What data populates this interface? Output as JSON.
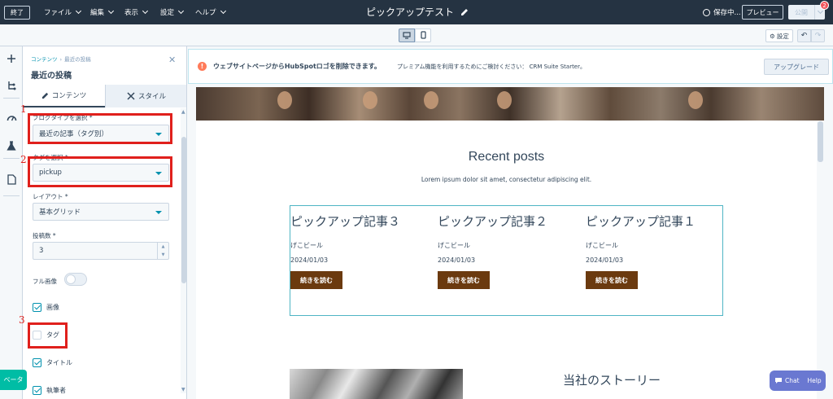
{
  "topbar": {
    "exit": "終了",
    "menus": [
      "ファイル",
      "編集",
      "表示",
      "設定",
      "ヘルプ"
    ],
    "title": "ピックアップテスト",
    "saving": "保存中...",
    "preview": "プレビュー",
    "publish": "公開",
    "notifications": "2"
  },
  "toolbar2": {
    "settings": "設定",
    "undo": "↶",
    "redo": "↷"
  },
  "panel": {
    "breadcrumb_root": "コンテンツ",
    "breadcrumb_sep": "›",
    "breadcrumb_current": "最近の投稿",
    "title": "最近の投稿",
    "close": "✕",
    "tabs": [
      "コンテンツ",
      "スタイル"
    ],
    "fields": {
      "blog_type_label": "ブログタイプを選択 *",
      "blog_type_value": "最近の記事（タグ別）",
      "tag_label": "タグを選択 *",
      "tag_value": "pickup",
      "layout_label": "レイアウト *",
      "layout_value": "基本グリッド",
      "count_label": "投稿数 *",
      "count_value": "3",
      "full_image_label": "フル画像",
      "image_label": "画像",
      "image_checked": true,
      "tag_cb_label": "タグ",
      "tag_cb_checked": false,
      "title_cb_label": "タイトル",
      "title_cb_checked": true,
      "author_cb_label": "執筆者"
    },
    "annotations": [
      "1",
      "2",
      "3"
    ]
  },
  "beta": "ベータ",
  "banner": {
    "bold": "ウェブサイトページからHubSpotロゴを削除できます。",
    "text": "プレミアム機能を利用するためにご検討ください： CRM Suite Starter。",
    "upgrade": "アップグレード"
  },
  "preview": {
    "recent_title": "Recent posts",
    "recent_sub": "Lorem ipsum dolor sit amet, consectetur adipiscing elit.",
    "posts": [
      {
        "title": "ピックアップ記事３",
        "author": "げこビール",
        "date": "2024/01/03",
        "button": "続きを読む"
      },
      {
        "title": "ピックアップ記事２",
        "author": "げこビール",
        "date": "2024/01/03",
        "button": "続きを読む"
      },
      {
        "title": "ピックアップ記事１",
        "author": "げこビール",
        "date": "2024/01/03",
        "button": "続きを読む"
      }
    ],
    "story_title": "当社のストーリー"
  },
  "chat": {
    "chat": "Chat",
    "help": "Help"
  },
  "colors": {
    "topbar": "#253342",
    "accent": "#0091ae",
    "annotation": "#e0201c",
    "button": "#6b3a0f",
    "beta": "#00bda5",
    "chat": "#6a78d1"
  }
}
